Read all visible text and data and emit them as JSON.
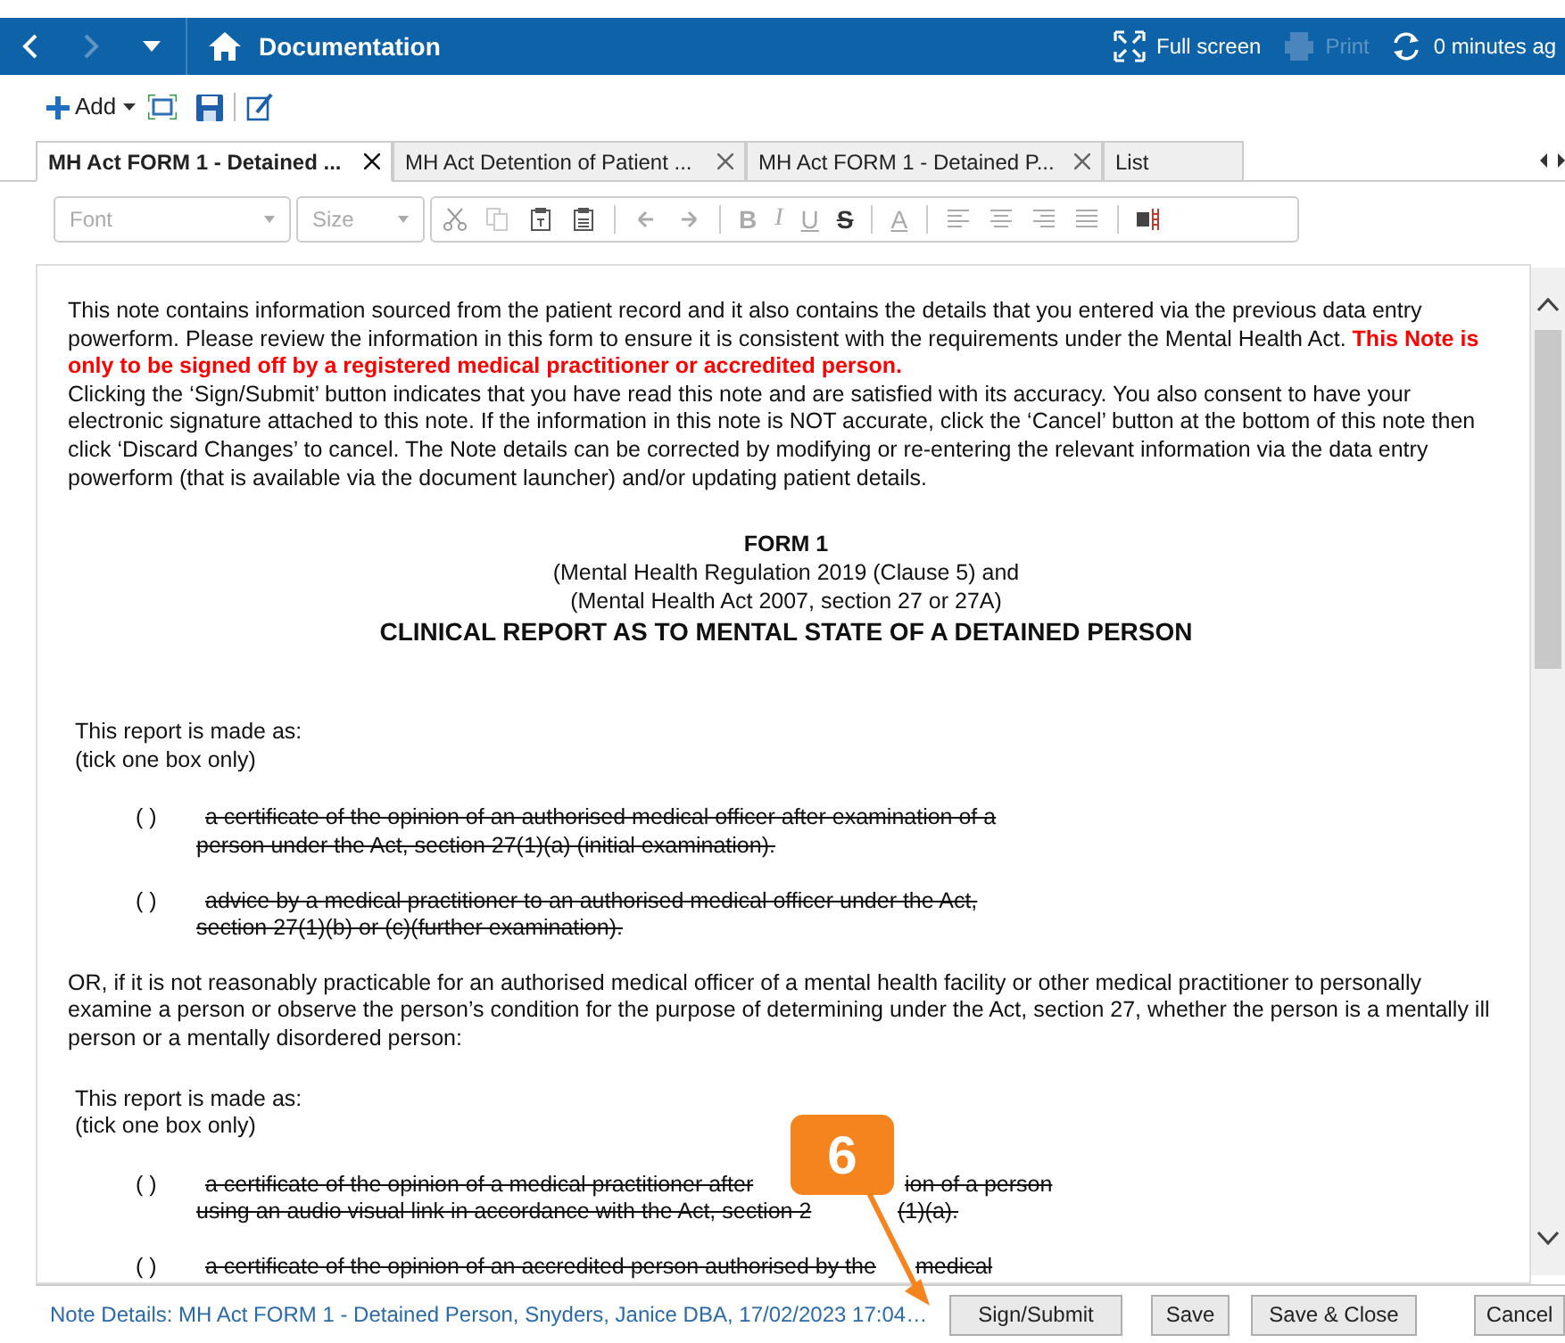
{
  "header": {
    "title": "Documentation",
    "actions": [
      {
        "kind": "fullscreen",
        "label": "Full screen",
        "disabled": false
      },
      {
        "kind": "print",
        "label": "Print",
        "disabled": true
      },
      {
        "kind": "refresh",
        "label": "0 minutes ag",
        "disabled": false
      }
    ]
  },
  "toolbar": {
    "add_label": "Add"
  },
  "tabs": [
    {
      "label": "MH Act FORM 1 - Detained ...",
      "selected": true,
      "closable": true
    },
    {
      "label": "MH Act Detention of Patient ...",
      "selected": false,
      "closable": true
    },
    {
      "label": "MH Act FORM 1 - Detained P...",
      "selected": false,
      "closable": true
    },
    {
      "label": "List",
      "selected": false,
      "closable": false
    }
  ],
  "format_toolbar": {
    "font_placeholder": "Font",
    "size_placeholder": "Size",
    "style_buttons": [
      {
        "kind": "bold",
        "label": "B"
      },
      {
        "kind": "italic",
        "label": "I"
      },
      {
        "kind": "underline",
        "label": "U"
      },
      {
        "kind": "strike",
        "label": "S"
      },
      {
        "kind": "color",
        "label": "A"
      }
    ]
  },
  "document": {
    "intro": [
      "This note contains information sourced from the patient record and it also contains the details that you entered via the previous data entry powerform. Please review the information in this form to ensure it is consistent with the requirements under the Mental Health Act. **This Note is only to be signed off by a registered medical practitioner or accredited person.**",
      "Clicking the ‘Sign/Submit’ button indicates that you have read this note and are satisfied with its accuracy. You also consent to have your electronic signature attached to this note. If the information in this note is NOT accurate, click the ‘Cancel’ button at the bottom of this note then click ‘Discard Changes’ to cancel. The Note details can be corrected by modifying or re-entering the relevant information via the data entry powerform (that is available via the document launcher) and/or updating patient details."
    ],
    "blocks": [
      {
        "kind": "heading",
        "form": "FORM 1",
        "subtitles": [
          "(Mental Health Regulation 2019 (Clause 5) and",
          "(Mental Health Act 2007, section 27 or 27A)"
        ],
        "title": "CLINICAL REPORT AS TO MENTAL STATE OF A DETAINED PERSON"
      },
      {
        "kind": "lines",
        "lines": [
          "This report is made as:",
          "(tick one box only)"
        ]
      },
      {
        "kind": "option",
        "marker": "( )",
        "struck": true,
        "lines": [
          [
            "a certificate of the opinion of an authorised medical officer after examination of a"
          ],
          [
            "person under the Act, section 27(1)(a) (initial examination)."
          ]
        ]
      },
      {
        "kind": "option",
        "marker": "( )",
        "struck": true,
        "lines": [
          [
            "advice by a medical practitioner to an authorised medical officer under the Act,"
          ],
          [
            "section 27(1)(b) or (c)(further examination)."
          ]
        ]
      },
      {
        "kind": "paragraph",
        "text": "OR, if it is not reasonably practicable for an authorised medical officer of a mental health facility or other medical practitioner to personally examine a person or observe the person’s condition for the purpose of determining under the Act, section 27, whether the person is a mentally ill person or a mentally disordered person:"
      },
      {
        "kind": "lines",
        "lines": [
          "This report is made as:",
          "(tick one box only)"
        ]
      },
      {
        "kind": "option",
        "marker": "( )",
        "struck": true,
        "lines": [
          [
            "a certificate of the opinion of a medical practitioner after",
            "ion of a person"
          ],
          [
            "using an audio visual link in accordance with the Act, section 2",
            "(1)(a)."
          ]
        ]
      },
      {
        "kind": "option",
        "marker": "( )",
        "struck": true,
        "lines": [
          [
            "a certificate of the opinion of an accredited person authorised by the",
            "medical"
          ]
        ]
      }
    ]
  },
  "footer": {
    "note_details": "Note Details: MH Act FORM 1 - Detained Person, Snyders, Janice  DBA, 17/02/2023 17:04…",
    "buttons": [
      "Sign/Submit",
      "Save",
      "Save & Close",
      "Cancel"
    ]
  },
  "callout": {
    "label": "6"
  }
}
